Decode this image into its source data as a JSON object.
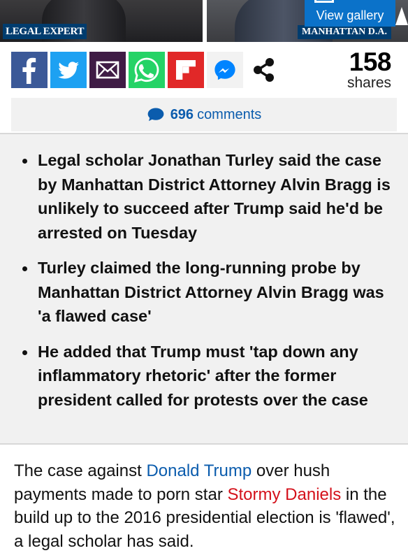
{
  "photo": {
    "caption_left": "LEGAL EXPERT",
    "caption_right": "MANHATTAN D.A.",
    "view_gallery_label": "View gallery"
  },
  "share": {
    "buttons": [
      {
        "name": "facebook-icon",
        "color": "#3b5998"
      },
      {
        "name": "twitter-icon",
        "color": "#1da1f2"
      },
      {
        "name": "email-icon",
        "color": "#3f1c45"
      },
      {
        "name": "whatsapp-icon",
        "color": "#25d366"
      },
      {
        "name": "flipboard-icon",
        "color": "#e12828"
      },
      {
        "name": "messenger-icon",
        "color": "#0084ff"
      },
      {
        "name": "share-icon",
        "color": "#000000"
      }
    ],
    "count": "158",
    "count_label": "shares"
  },
  "comments": {
    "count": "696",
    "label": "comments"
  },
  "summary": {
    "bullets": [
      "Legal scholar Jonathan Turley said the case by Manhattan District Attorney Alvin Bragg is unlikely to succeed after Trump said he'd be arrested on Tuesday",
      "Turley claimed the long-running probe by Manhattan District Attorney Alvin Bragg was 'a flawed case'",
      "He added that Trump must 'tap down any inflammatory rhetoric' after the former president called for protests over the case"
    ]
  },
  "article": {
    "part1": "The case against ",
    "link1": "Donald Trump",
    "part2": " over hush payments made to porn star ",
    "link2": "Stormy Daniels",
    "part3": " in the build up to the 2016 presidential election is 'flawed', a legal scholar has said."
  },
  "colors": {
    "link_blue": "#0b5cad",
    "link_red": "#d4111b",
    "caption_bg": "#003c6e",
    "gallery_bg": "#0b72c9"
  }
}
